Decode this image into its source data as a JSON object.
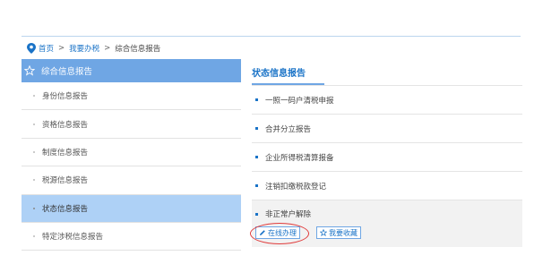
{
  "breadcrumb": {
    "home": "首页",
    "tax": "我要办税",
    "current": "综合信息报告",
    "separator": ">"
  },
  "sidebar": {
    "title": "综合信息报告",
    "items": [
      {
        "label": "身份信息报告"
      },
      {
        "label": "资格信息报告"
      },
      {
        "label": "制度信息报告"
      },
      {
        "label": "税源信息报告"
      },
      {
        "label": "状态信息报告",
        "active": true
      },
      {
        "label": "特定涉税信息报告"
      }
    ]
  },
  "panel": {
    "tab": "状态信息报告",
    "items": [
      {
        "label": "一照一码户清税申报"
      },
      {
        "label": "合并分立报告"
      },
      {
        "label": "企业所得税清算报备"
      },
      {
        "label": "注销扣缴税款登记"
      },
      {
        "label": "非正常户解除"
      }
    ],
    "actions": {
      "online": "在线办理",
      "favorite": "我要收藏"
    }
  },
  "colors": {
    "accent": "#6fa6e4",
    "active_bg": "#aed1f6",
    "link": "#1a73c7",
    "highlight_circle": "#e03c3c"
  }
}
